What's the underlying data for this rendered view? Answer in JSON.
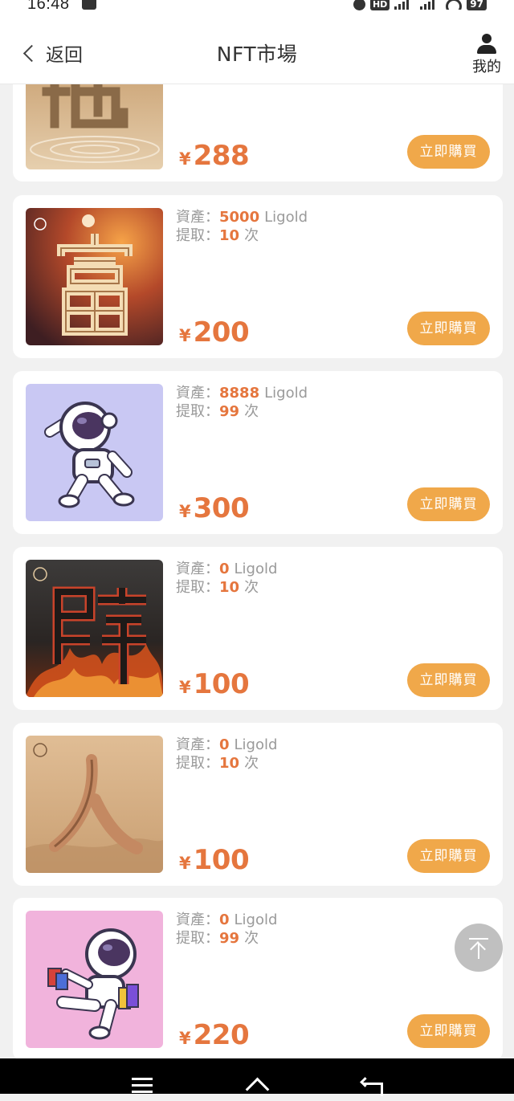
{
  "status_bar": {
    "time": "16:48",
    "hd": "HD",
    "battery": "97"
  },
  "header": {
    "back_label": "返回",
    "title": "NFT市場",
    "mine_label": "我的"
  },
  "labels": {
    "asset_label": "資產：",
    "extract_label": "提取：",
    "currency_unit": "Ligold",
    "times_unit": "次",
    "yen": "¥",
    "buy_label": "立即購買"
  },
  "items": [
    {
      "name": "地",
      "asset": "",
      "extract": "",
      "price": "288",
      "icon": "earth-character-icon"
    },
    {
      "name": "富",
      "asset": "5000",
      "extract": "10",
      "price": "200",
      "icon": "fortune-character-icon"
    },
    {
      "name": "astronaut-dab",
      "asset": "8888",
      "extract": "99",
      "price": "300",
      "icon": "astronaut-dab-icon"
    },
    {
      "name": "辟",
      "asset": "0",
      "extract": "10",
      "price": "100",
      "icon": "fire-character-icon"
    },
    {
      "name": "人",
      "asset": "0",
      "extract": "10",
      "price": "100",
      "icon": "person-character-icon"
    },
    {
      "name": "astronaut-shopping",
      "asset": "0",
      "extract": "99",
      "price": "220",
      "icon": "astronaut-shopping-icon"
    }
  ],
  "colors": {
    "accent": "#e5763e",
    "button": "#f0a84a",
    "background": "#f1f1f1"
  }
}
